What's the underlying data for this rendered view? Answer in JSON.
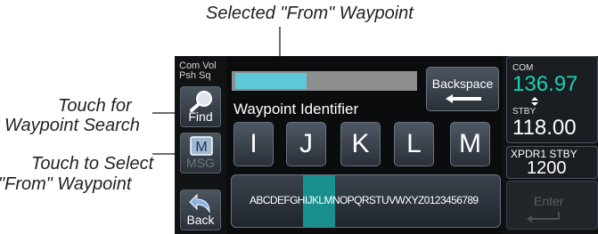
{
  "callouts": {
    "selected_from_waypoint": "Selected \"From\" Waypoint",
    "touch_waypoint_search_line1": "Touch for",
    "touch_waypoint_search_line2": "Waypoint Search",
    "touch_select_from_line1": "Touch to Select",
    "touch_select_from_line2": "\"From\" Waypoint"
  },
  "left_panel": {
    "comvol_line1": "Com Vol",
    "comvol_line2": "Psh Sq",
    "find_label": "Find",
    "msg_label": "MSG",
    "back_label": "Back"
  },
  "entry": {
    "identifier_label": "Waypoint Identifier",
    "backspace_label": "Backspace",
    "keys": [
      "I",
      "J",
      "K",
      "L",
      "M"
    ],
    "alphabet_strip": "ABCDEFGHIJKLMNOPQRSTUVWXYZ0123456789"
  },
  "radio": {
    "com_label": "COM",
    "com_freq": "136.97",
    "stby_label": "STBY",
    "stby_freq": "118.00",
    "xpdr_label": "XPDR1 STBY",
    "squawk": "1200",
    "enter_label": "Enter",
    "colors": {
      "active_freq": "#18d2b4",
      "text": "#ffffff",
      "highlight": "#1a8f8f",
      "id_fill": "#5ec8d8"
    }
  }
}
